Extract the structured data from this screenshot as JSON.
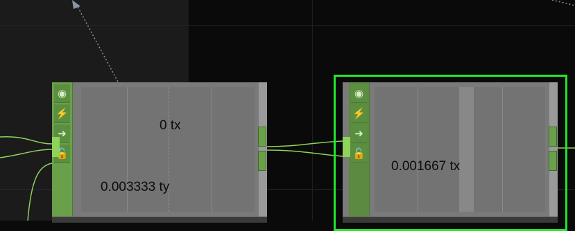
{
  "nodes": [
    {
      "id": "left",
      "labels": [
        "0 tx",
        "0.003333 ty"
      ]
    },
    {
      "id": "right",
      "labels": [
        "0.001667 tx"
      ],
      "selected": true
    }
  ],
  "strip_icons": [
    "target-icon",
    "bolt-icon",
    "arrow-right-icon",
    "lock-icon"
  ],
  "strip_glyphs": [
    "◉",
    "⚡",
    "➜",
    "🔓"
  ],
  "colors": {
    "selection": "#23e52c",
    "node_strip": "#6aa04a",
    "inlet": "#8ed35a",
    "wire": "#8ed35a"
  }
}
